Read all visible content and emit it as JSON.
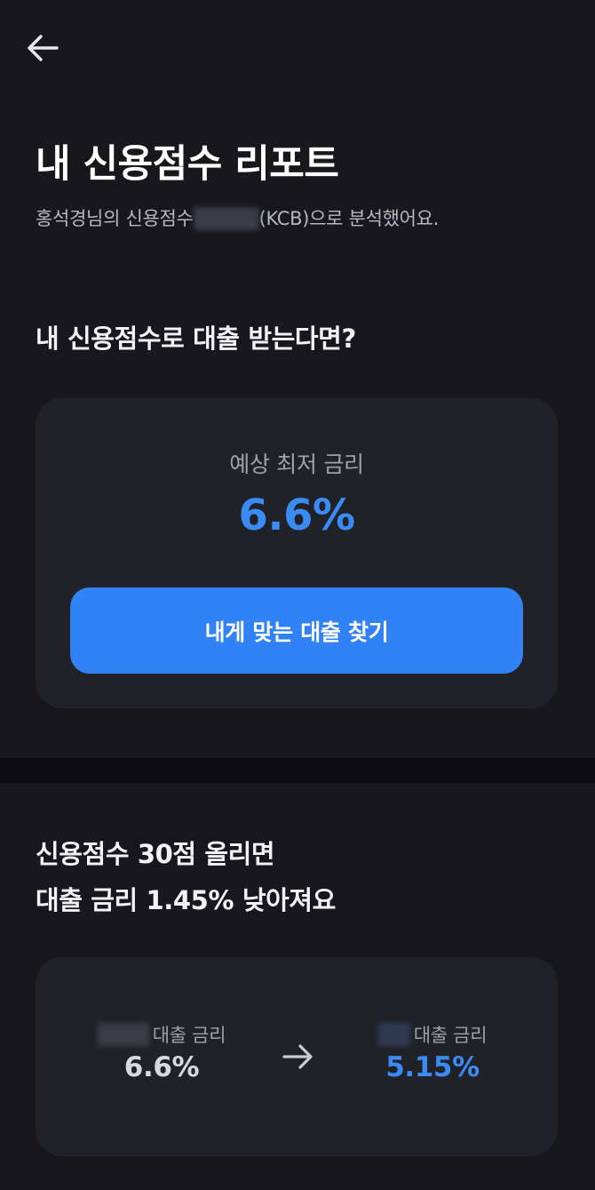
{
  "header": {
    "back_icon": "arrow-left-icon"
  },
  "report": {
    "title": "내 신용점수 리포트",
    "subtitle_prefix": "홍석경님의 신용점수",
    "subtitle_suffix": "(KCB)으로 분석했어요."
  },
  "loan_section": {
    "heading": "내 신용점수로 대출 받는다면?",
    "rate_label": "예상 최저 금리",
    "rate_value": "6.6%",
    "cta_label": "내게 맞는 대출 찾기"
  },
  "improve_section": {
    "heading_line1": "신용점수 30점 올리면",
    "heading_line2": "대출 금리 1.45% 낮아져요",
    "current": {
      "label": "대출 금리",
      "value": "6.6%"
    },
    "arrow_icon": "arrow-right-icon",
    "improved": {
      "label": "대출 금리",
      "value": "5.15%"
    }
  },
  "colors": {
    "background": "#17171c",
    "card": "#202228",
    "accent": "#3182f6",
    "accent_text": "#3b8bf5",
    "muted_text": "#9ea1a9"
  }
}
